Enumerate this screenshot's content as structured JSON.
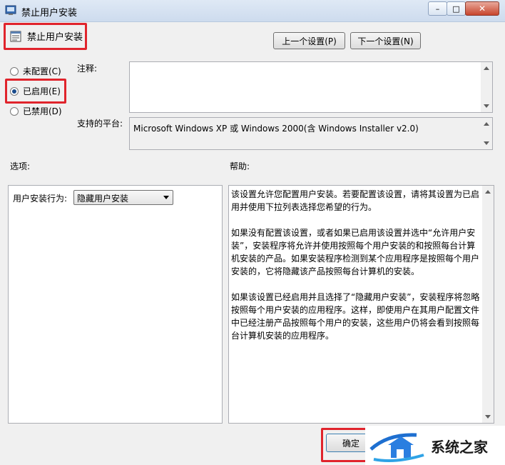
{
  "window": {
    "title": "禁止用户安装"
  },
  "titlebar_buttons": {
    "minimize": "–",
    "maximize": "□",
    "close": "✕"
  },
  "policy": {
    "name": "禁止用户安装"
  },
  "nav": {
    "prev": "上一个设置(P)",
    "next": "下一个设置(N)"
  },
  "radios": [
    {
      "label": "未配置(C)",
      "checked": false
    },
    {
      "label": "已启用(E)",
      "checked": true
    },
    {
      "label": "已禁用(D)",
      "checked": false
    }
  ],
  "comment": {
    "label": "注释:",
    "value": ""
  },
  "platform": {
    "label": "支持的平台:",
    "value": "Microsoft Windows XP 或 Windows 2000(含 Windows Installer v2.0)"
  },
  "options": {
    "label": "选项:",
    "field_label": "用户安装行为:",
    "selected": "隐藏用户安装"
  },
  "help": {
    "label": "帮助:",
    "paragraphs": [
      "该设置允许您配置用户安装。若要配置该设置，请将其设置为已启用并使用下拉列表选择您希望的行为。",
      "如果没有配置该设置，或者如果已启用该设置并选中“允许用户安装”，安装程序将允许并使用按照每个用户安装的和按照每台计算机安装的产品。如果安装程序检测到某个应用程序是按照每个用户安装的，它将隐藏该产品按照每台计算机的安装。",
      "如果该设置已经启用并且选择了“隐藏用户安装”，安装程序将忽略按照每个用户安装的应用程序。这样，即使用户在其用户配置文件中已经注册产品按照每个用户的安装，这些用户仍将会看到按照每台计算机安装的应用程序。"
    ]
  },
  "footer": {
    "ok": "确定"
  },
  "watermark": {
    "text": "系统之家"
  },
  "colors": {
    "highlight": "#e0242c",
    "accent": "#1b4c8c"
  }
}
